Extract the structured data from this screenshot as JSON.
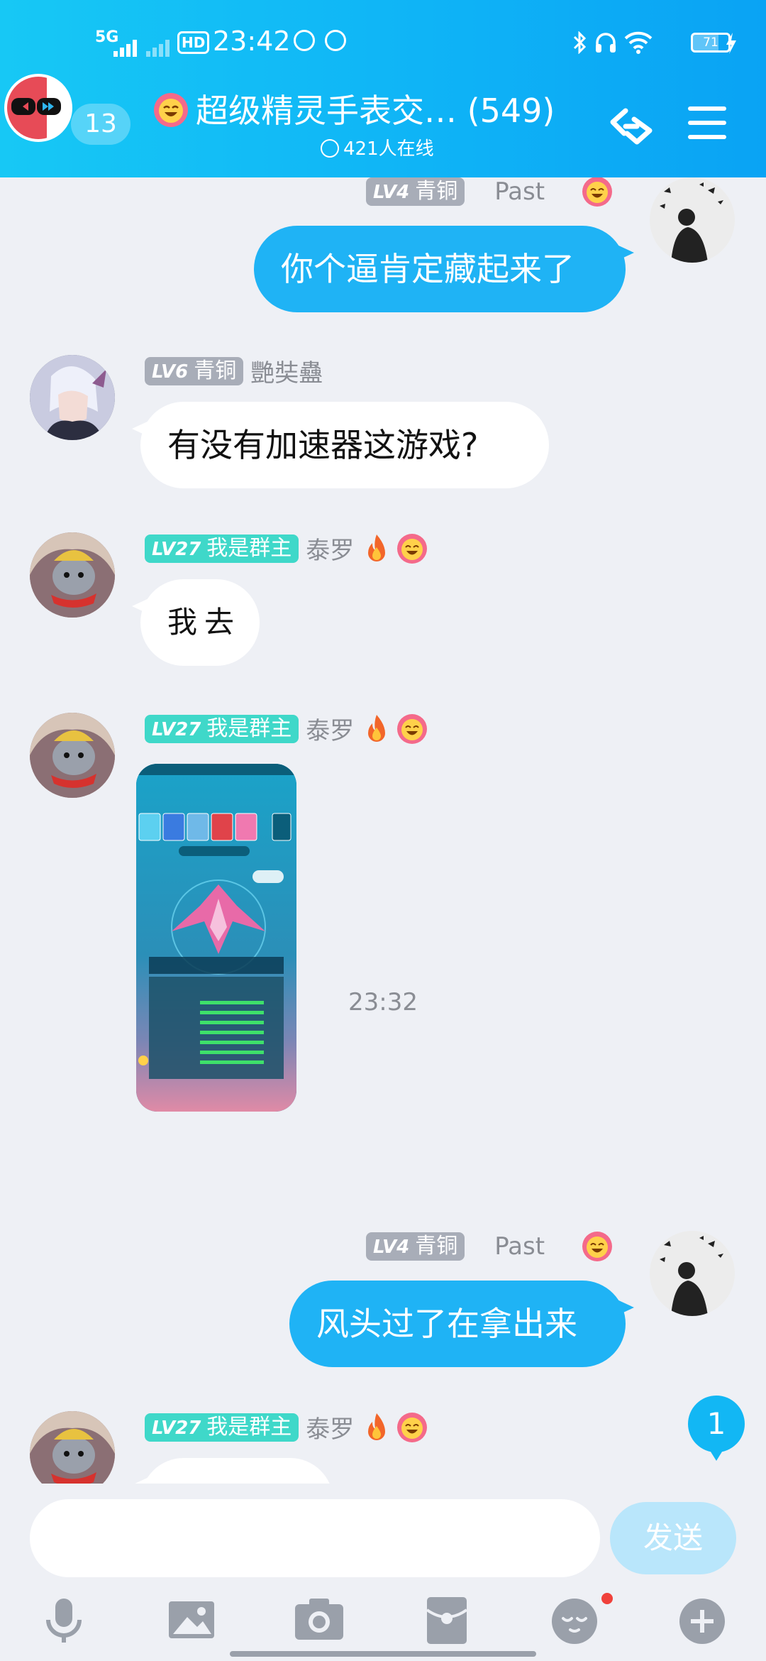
{
  "status_bar": {
    "network": "5G",
    "hd": "HD",
    "time": "23:42",
    "battery": "71",
    "battery_level": 0.71
  },
  "header": {
    "unread_count": "13",
    "title": "超级精灵手表交… (549)",
    "online": "421人在线",
    "menu_icon": "menu-icon",
    "share_icon": "share-link-icon",
    "accent": "#12b4f5"
  },
  "messages": [
    {
      "side": "mine",
      "level": "LV4",
      "rank": "青铜",
      "nick": "Past",
      "text": "你个逼肯定藏起来了"
    },
    {
      "side": "theirs",
      "level": "LV6",
      "rank": "青铜",
      "nick": "艷奘蠱",
      "text": "有没有加速器这游戏?"
    },
    {
      "side": "theirs",
      "level": "LV27",
      "rank": "我是群主",
      "nick": "泰罗",
      "text": "我去"
    },
    {
      "side": "theirs",
      "level": "LV27",
      "rank": "我是群主",
      "nick": "泰罗",
      "image": "game-screenshot"
    },
    {
      "time_divider": "23:32"
    },
    {
      "side": "mine",
      "level": "LV4",
      "rank": "青铜",
      "nick": "Past",
      "text": "风头过了在拿出来"
    },
    {
      "side": "theirs",
      "level": "LV27",
      "rank": "我是群主",
      "nick": "泰罗",
      "text": ""
    }
  ],
  "new_message_badge": "1",
  "input": {
    "placeholder": "",
    "send_label": "发送"
  },
  "toolbar": [
    "microphone-icon",
    "image-icon",
    "camera-icon",
    "red-packet-icon",
    "emoji-icon",
    "plus-icon"
  ]
}
